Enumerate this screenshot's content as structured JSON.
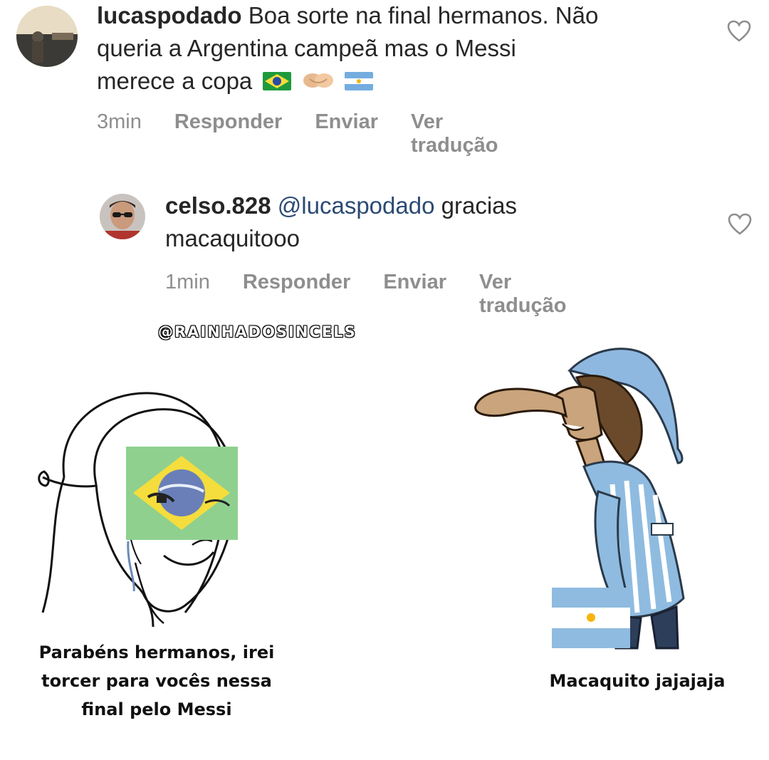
{
  "comments": [
    {
      "username": "lucaspodado",
      "line1": "Boa sorte na final hermanos. Não",
      "line2": "queria a Argentina campeã mas o Messi",
      "line3": "merece a copa",
      "emoji": [
        "brazil-flag",
        "handshake",
        "argentina-flag"
      ],
      "time": "3min",
      "reply": "Responder",
      "send": "Enviar",
      "translate": "Ver tradução"
    },
    {
      "username": "celso.828",
      "mention": "@lucaspodado",
      "line1_rest": "gracias",
      "line2": "macaquitooo",
      "time": "1min",
      "reply": "Responder",
      "send": "Enviar",
      "translate": "Ver tradução"
    }
  ],
  "watermark": "@RAINHADOSINCELS",
  "meme": {
    "left_caption": [
      "Parabéns hermanos, irei",
      "torcer para vocês nessa",
      "final pelo Messi"
    ],
    "right_caption": "Macaquito jajajaja"
  },
  "colors": {
    "text": "#262626",
    "meta": "#8e8e8e",
    "mention": "#2b4a73",
    "brazil_green": "#8fd08f",
    "brazil_yellow": "#f4dd3c",
    "brazil_blue": "#6a7fb8",
    "argentina_blue": "#8fbbe0"
  }
}
